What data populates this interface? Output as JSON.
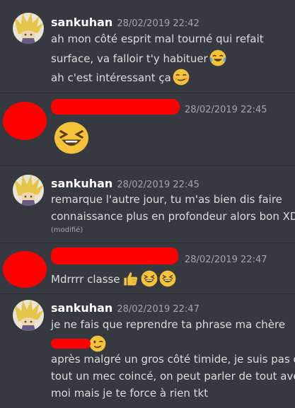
{
  "messages": [
    {
      "author": "sankuhan",
      "timestamp": "28/02/2019 22:42",
      "lines": [
        "ah mon côté esprit mal tourné qui refait",
        "surface, va falloir t'y habituer",
        "ah c'est intéressant ça"
      ]
    },
    {
      "author": "",
      "timestamp": "28/02/2019 22:45",
      "emoji": "laughing-emoji"
    },
    {
      "author": "sankuhan",
      "timestamp": "28/02/2019 22:45",
      "lines": [
        "remarque l'autre jour, tu m'as bien dis faire",
        "connaissance plus en profondeur alors bon XD"
      ],
      "edited": "(modifié)"
    },
    {
      "author": "",
      "timestamp": "28/02/2019 22:47",
      "lines": [
        "Mdrrrr classe"
      ]
    },
    {
      "author": "sankuhan",
      "timestamp": "28/02/2019 22:47",
      "lines": [
        "je ne fais que reprendre ta phrase ma chère",
        "après malgré un gros côté timide, je suis pas du",
        "tout un mec coincé, on peut parler de tout avec",
        "moi mais je te force à rien tkt"
      ]
    }
  ],
  "colors": {
    "background": "#36393f",
    "username": "#ffffff",
    "text": "#dcddde",
    "muted": "#a3a6aa",
    "redaction": "#ff0000",
    "emoji": "#f5c33b"
  }
}
